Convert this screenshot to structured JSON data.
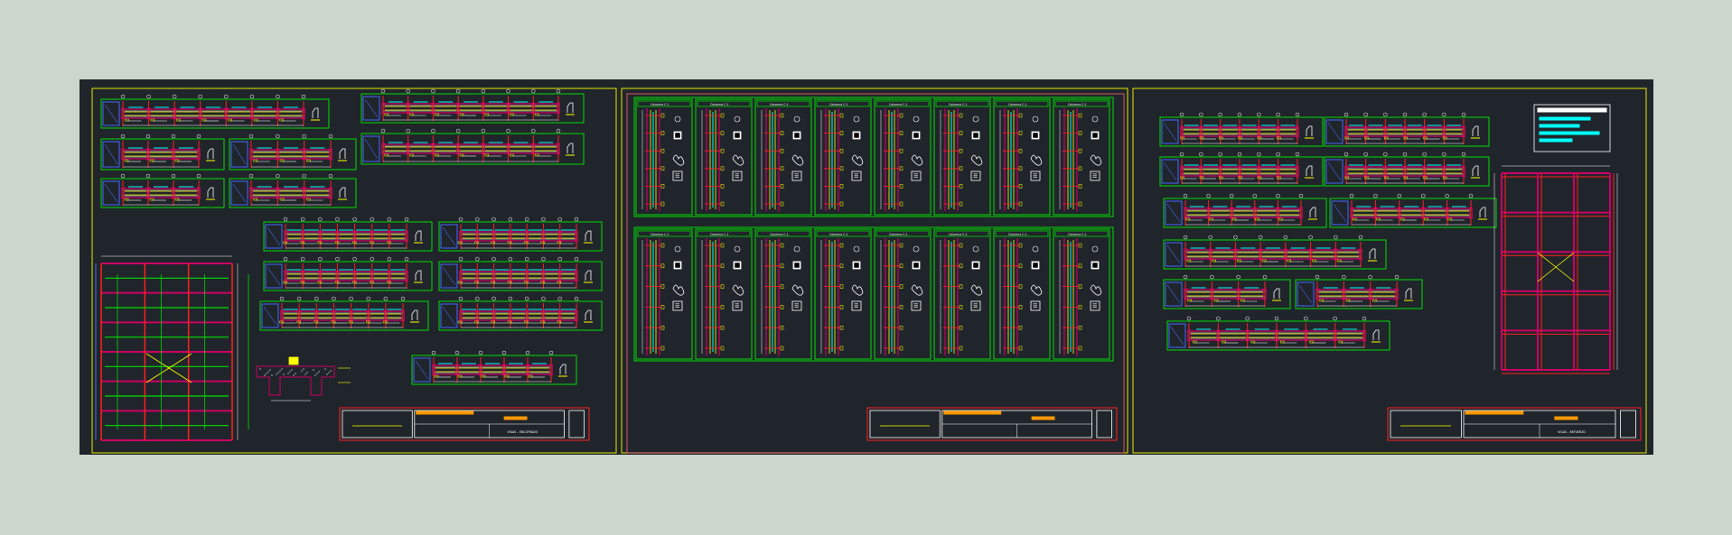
{
  "drawing": {
    "sheet_count": 3,
    "colors": {
      "background": "#ccd6cc",
      "model_space": "#20252b",
      "sheet_border": "#e6e600",
      "viewport": "#00dd00",
      "beam": "#cc0066",
      "axis": "#ff2020",
      "rebar": "#ffff00",
      "stirrup": "#00ffff",
      "detail": "#4466ff",
      "text": "#ffffff",
      "title_block_orange": "#ff9900"
    },
    "column_label": "Columna C-1",
    "title_block_text": [
      "VIGAS – ENCOFRADO",
      "",
      "VIGAS – REFUERZO"
    ]
  }
}
